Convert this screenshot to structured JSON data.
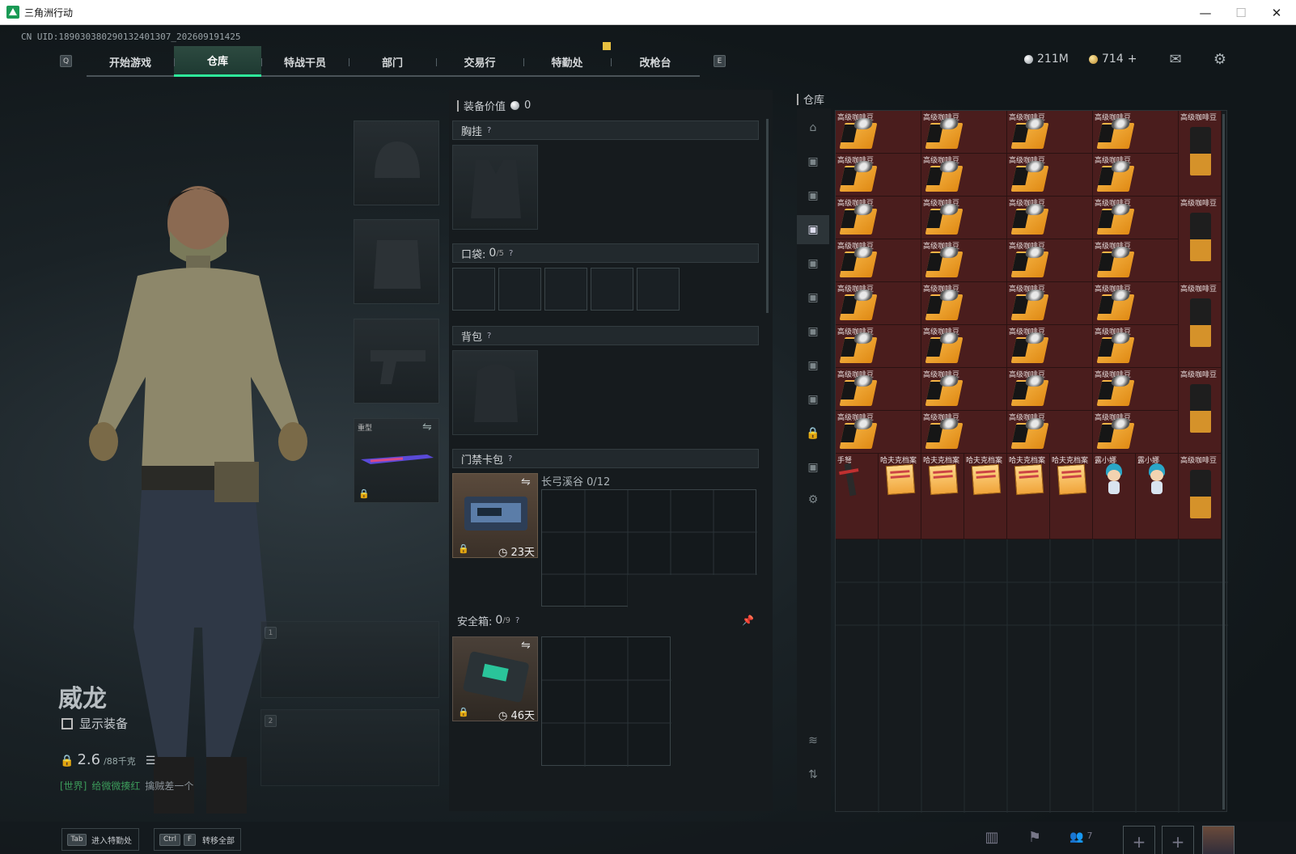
{
  "window": {
    "title": "三角洲行动",
    "minimize": "—",
    "maximize": "☐",
    "close": "✕"
  },
  "uid": "CN UID:189030380290132401307_202609191425",
  "nav": {
    "left_key": "Q",
    "right_key": "E",
    "tabs": [
      {
        "label": "开始游戏",
        "active": false
      },
      {
        "label": "仓库",
        "active": true
      },
      {
        "label": "特战干员",
        "active": false
      },
      {
        "label": "部门",
        "active": false
      },
      {
        "label": "交易行",
        "active": false
      },
      {
        "label": "特勤处",
        "active": false
      },
      {
        "label": "改枪台",
        "active": false
      }
    ]
  },
  "currency": {
    "silver": "211M",
    "gold": "714",
    "add": "+"
  },
  "icons": {
    "mail": "mail-icon",
    "settings": "gear-icon"
  },
  "operator": {
    "name": "威龙",
    "show_gear_label": "显示装备",
    "weight_value": "2.6",
    "weight_max": "/88千克",
    "chat_channel": "[世界]",
    "chat_text": "给微微揍红",
    "chat_text2": "擒贼差一个"
  },
  "loadout": {
    "melee_label": "重型",
    "weapon_slot_1": "1",
    "weapon_slot_2": "2"
  },
  "equipment": {
    "value_label": "装备价值",
    "value": "0",
    "chest_rig": "胸挂",
    "pocket_label": "口袋:",
    "pocket_count": "0",
    "pocket_max": "/5",
    "backpack": "背包",
    "keycard_label": "门禁卡包",
    "keycard_map": "长弓溪谷 0/12",
    "keycard_days": "23天",
    "safebox_label": "安全箱:",
    "safebox_count": "0",
    "safebox_max": "/9",
    "safebox_days": "46天",
    "help": "?"
  },
  "warehouse": {
    "title": "仓库",
    "bean_label": "高级咖啡豆",
    "last_row": [
      {
        "label": "手弩",
        "kind": "crossbow"
      },
      {
        "label": "哈夫克档案",
        "kind": "paper"
      },
      {
        "label": "哈夫克档案",
        "kind": "paper"
      },
      {
        "label": "哈夫克档案",
        "kind": "paper"
      },
      {
        "label": "哈夫克档案",
        "kind": "paper"
      },
      {
        "label": "哈夫克档案",
        "kind": "paper"
      },
      {
        "label": "露小娜",
        "kind": "doll"
      },
      {
        "label": "露小娜",
        "kind": "doll"
      },
      {
        "label": "高级咖啡豆",
        "kind": "bag"
      }
    ]
  },
  "bottom": {
    "tab_key": "Tab",
    "tab_label": "进入特勤处",
    "ctrl_key": "Ctrl",
    "f_key": "F",
    "ctrl_label": "转移全部",
    "friends_count": "7"
  },
  "colors": {
    "accent": "#2ee89a",
    "item_bg": "#4a1d1d"
  }
}
